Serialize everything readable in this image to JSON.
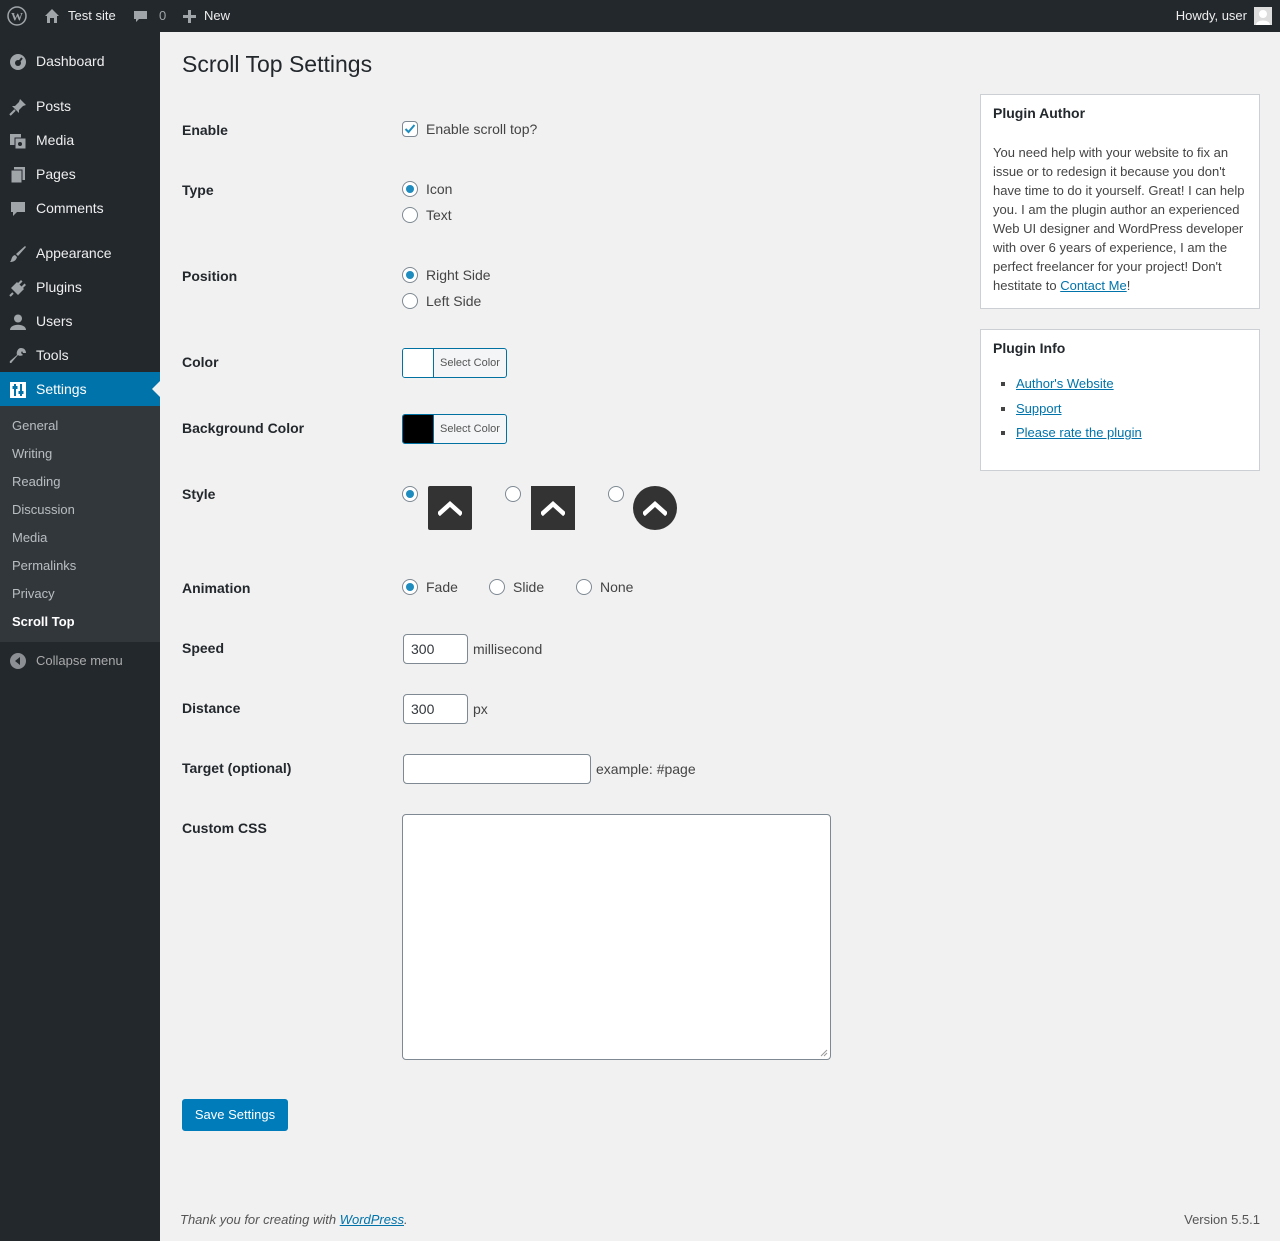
{
  "adminbar": {
    "site_name": "Test site",
    "comments_count": "0",
    "new_label": "New",
    "howdy": "Howdy, user"
  },
  "sidebar": {
    "items": [
      {
        "label": "Dashboard",
        "icon": "dashboard-icon"
      },
      {
        "label": "Posts",
        "icon": "pin-icon"
      },
      {
        "label": "Media",
        "icon": "media-icon"
      },
      {
        "label": "Pages",
        "icon": "pages-icon"
      },
      {
        "label": "Comments",
        "icon": "comment-icon"
      },
      {
        "label": "Appearance",
        "icon": "brush-icon"
      },
      {
        "label": "Plugins",
        "icon": "plug-icon"
      },
      {
        "label": "Users",
        "icon": "user-icon"
      },
      {
        "label": "Tools",
        "icon": "wrench-icon"
      },
      {
        "label": "Settings",
        "icon": "sliders-icon"
      }
    ],
    "submenu": [
      "General",
      "Writing",
      "Reading",
      "Discussion",
      "Media",
      "Permalinks",
      "Privacy",
      "Scroll Top"
    ],
    "collapse_label": "Collapse menu"
  },
  "page": {
    "title": "Scroll Top Settings",
    "enable": {
      "label": "Enable",
      "checkbox_label": "Enable scroll top?",
      "checked": true
    },
    "type": {
      "label": "Type",
      "options": [
        "Icon",
        "Text"
      ],
      "selected": "Icon"
    },
    "position": {
      "label": "Position",
      "options": [
        "Right Side",
        "Left Side"
      ],
      "selected": "Right Side"
    },
    "color": {
      "label": "Color",
      "button_label": "Select Color",
      "value": "#ffffff"
    },
    "background_color": {
      "label": "Background Color",
      "button_label": "Select Color",
      "value": "#000000"
    },
    "style": {
      "label": "Style",
      "selected_index": 0
    },
    "animation": {
      "label": "Animation",
      "options": [
        "Fade",
        "Slide",
        "None"
      ],
      "selected": "Fade"
    },
    "speed": {
      "label": "Speed",
      "value": "300",
      "unit": "millisecond"
    },
    "distance": {
      "label": "Distance",
      "value": "300",
      "unit": "px"
    },
    "target": {
      "label": "Target (optional)",
      "value": "",
      "hint": "example: #page"
    },
    "custom_css": {
      "label": "Custom CSS",
      "value": ""
    },
    "save_label": "Save Settings"
  },
  "plugin_author": {
    "title": "Plugin Author",
    "text": "You need help with your website to fix an issue or to redesign it because you don't have time to do it yourself. Great! I can help you. I am the plugin author an experienced Web UI designer and WordPress developer with over 6 years of experience, I am the perfect freelancer for your project! Don't hestitate to ",
    "link_label": "Contact Me",
    "after_link": "!"
  },
  "plugin_info": {
    "title": "Plugin Info",
    "links": [
      "Author's Website",
      "Support",
      "Please rate the plugin"
    ]
  },
  "footer": {
    "thanks_prefix": "Thank you for creating with ",
    "wordpress_link": "WordPress",
    "thanks_suffix": ".",
    "version": "Version 5.5.1"
  },
  "colors": {
    "accent": "#0073aa",
    "sidebar_bg": "#23282d",
    "submenu_bg": "#32373c",
    "button": "#007cba"
  }
}
